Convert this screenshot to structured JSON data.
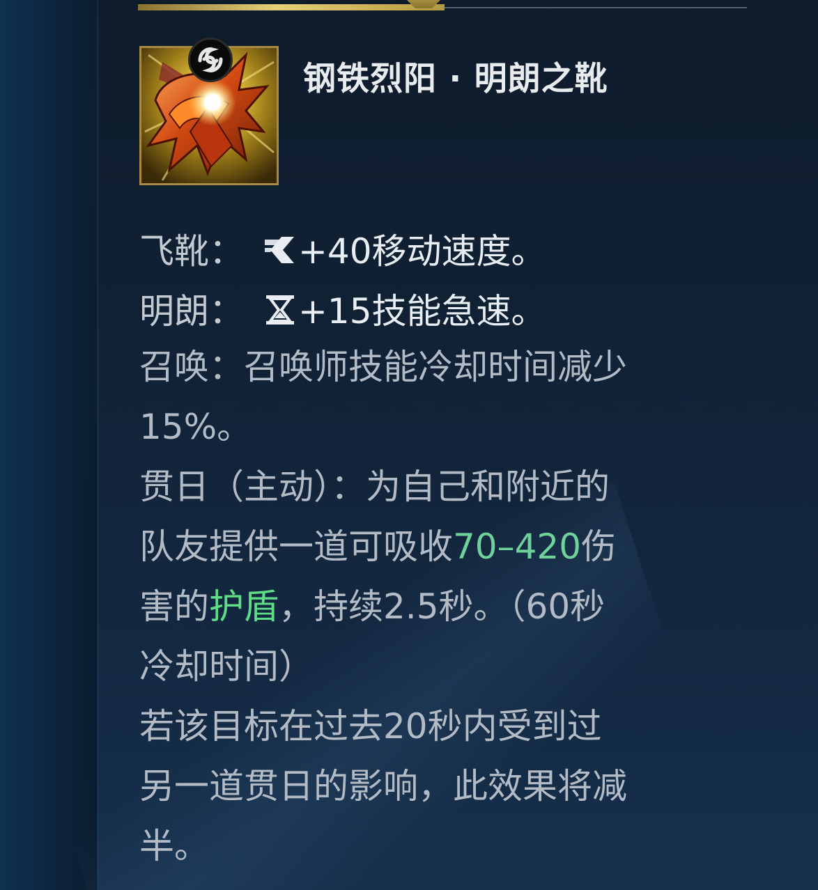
{
  "item": {
    "name": "钢铁烈阳 · 明朗之靴",
    "icon": "burning-sun-boots-icon",
    "badge_icon": "active-item-swirl-icon"
  },
  "stats": [
    {
      "label": "飞靴：",
      "icon": "move-speed-icon",
      "value": "+40移动速度。"
    },
    {
      "label": "明朗：",
      "icon": "ability-haste-hourglass-icon",
      "value": "+15技能急速。"
    }
  ],
  "description": {
    "summon_line1": "召唤：召唤师技能冷却时间减少",
    "summon_line2": "15%。",
    "active_line1": "贯日（主动）：为自己和附近的",
    "active_line2_prefix": "队友提供一道可吸收",
    "active_line2_value": "70–420",
    "active_line2_suffix": "伤",
    "active_line3_prefix": "害的",
    "active_line3_shield": "护盾",
    "active_line3_suffix": "，持续2.5秒。（60秒",
    "active_line4": "冷却时间）",
    "halve_line1": "若该目标在过去20秒内受到过",
    "halve_line2": "另一道贯日的影响，此效果将减",
    "halve_line3": "半。"
  },
  "colors": {
    "gold_bar": "#e6cf7a",
    "number_highlight": "#6fd29a",
    "shield_highlight": "#5fdc86",
    "text": "#b3bcc6",
    "title": "#e9ecef"
  }
}
